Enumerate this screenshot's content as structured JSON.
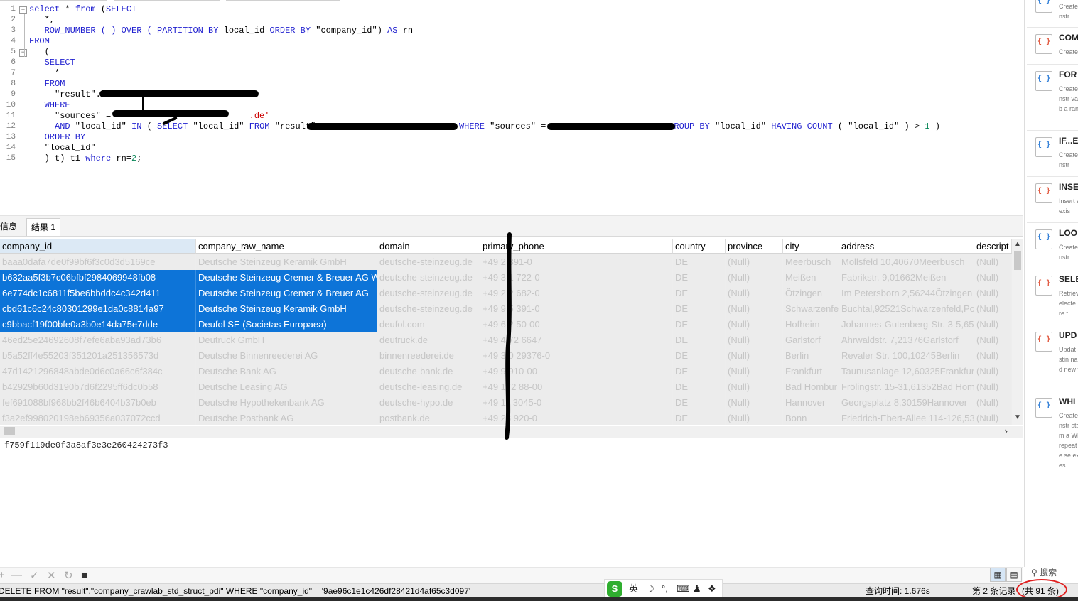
{
  "editor": {
    "line_numbers": [
      "1",
      "2",
      "3",
      "4",
      "5",
      "6",
      "7",
      "8",
      "9",
      "10",
      "11",
      "12",
      "13",
      "14",
      "15"
    ],
    "code_lines": [
      [
        {
          "t": "select",
          "c": "kw"
        },
        {
          "t": " * "
        },
        {
          "t": "from",
          "c": "kw"
        },
        {
          "t": " ("
        },
        {
          "t": "SELECT",
          "c": "kw"
        }
      ],
      [
        {
          "t": "   *,"
        }
      ],
      [
        {
          "t": "   ROW_NUMBER ( ) OVER ( PARTITION BY",
          "c": "kw"
        },
        {
          "t": " local_id "
        },
        {
          "t": "ORDER BY",
          "c": "kw"
        },
        {
          "t": " \"company_id\") "
        },
        {
          "t": "AS",
          "c": "kw"
        },
        {
          "t": " rn"
        }
      ],
      [
        {
          "t": "FROM",
          "c": "kw"
        }
      ],
      [
        {
          "t": "   ("
        }
      ],
      [
        {
          "t": "   SELECT",
          "c": "kw"
        }
      ],
      [
        {
          "t": "     *"
        }
      ],
      [
        {
          "t": "   FROM",
          "c": "kw"
        }
      ],
      [
        {
          "t": "     \"result\".\""
        }
      ],
      [
        {
          "t": "   WHERE",
          "c": "kw"
        }
      ],
      [
        {
          "t": "     \"sources\" = '"
        },
        {
          "t": "                         .de'",
          "c": "str"
        }
      ],
      [
        {
          "t": "     AND",
          "c": "kw"
        },
        {
          "t": " \"local_id\" "
        },
        {
          "t": "IN",
          "c": "kw"
        },
        {
          "t": " ( "
        },
        {
          "t": "SELECT",
          "c": "kw"
        },
        {
          "t": " \"local_id\" "
        },
        {
          "t": "FROM",
          "c": "kw"
        },
        {
          "t": " \"result\".                           "
        },
        {
          "t": "WHERE",
          "c": "kw"
        },
        {
          "t": " \"sources\" =                        "
        },
        {
          "t": "GROUP BY",
          "c": "kw"
        },
        {
          "t": " \"local_id\" "
        },
        {
          "t": "HAVING",
          "c": "kw"
        },
        {
          "t": " "
        },
        {
          "t": "COUNT",
          "c": "kw"
        },
        {
          "t": " ( \"local_id\" ) > "
        },
        {
          "t": "1",
          "c": "num"
        },
        {
          "t": " )"
        }
      ],
      [
        {
          "t": "   ORDER BY",
          "c": "kw"
        }
      ],
      [
        {
          "t": "   \"local_id\""
        }
      ],
      [
        {
          "t": "   ) t) t1 "
        },
        {
          "t": "where",
          "c": "kw"
        },
        {
          "t": " rn="
        },
        {
          "t": "2",
          "c": "num"
        },
        {
          "t": ";"
        }
      ]
    ]
  },
  "result_tabs": {
    "info": "信息",
    "result1": "结果 1"
  },
  "grid": {
    "columns": [
      "company_id",
      "company_raw_name",
      "domain",
      "primary_phone",
      "country",
      "province",
      "city",
      "address",
      "descript"
    ],
    "rows": [
      {
        "selected": false,
        "cells": [
          "baaa0dafa7de0f99bf6f3c0d3d5169ce",
          "Deutsche Steinzeug Keramik GmbH",
          "deutsche-steinzeug.de",
          "+49 2  391-0",
          "DE",
          "(Null)",
          "Meerbusch",
          "Mollsfeld 10,40670Meerbusch",
          "(Null)"
        ]
      },
      {
        "selected": true,
        "cells": [
          "b632aa5f3b7c06bfbf2984069948fb08",
          "Deutsche Steinzeug Cremer & Breuer AG W",
          "deutsche-steinzeug.de",
          "+49 3  1 722-0",
          "DE",
          "(Null)",
          "Meißen",
          "Fabrikstr. 9,01662Meißen",
          "(Null)"
        ]
      },
      {
        "selected": true,
        "cells": [
          "6e774dc1c6811f5be6bbddc4c342d411",
          "Deutsche Steinzeug Cremer & Breuer AG",
          "deutsche-steinzeug.de",
          "+49 2  2 682-0",
          "DE",
          "(Null)",
          "Ötzingen",
          "Im Petersborn 2,56244Ötzingen",
          "(Null)"
        ]
      },
      {
        "selected": true,
        "cells": [
          "cbd61c6c24c80301299e1da0c8814a97",
          "Deutsche Steinzeug Keramik GmbH",
          "deutsche-steinzeug.de",
          "+49 9  5 391-0",
          "DE",
          "(Null)",
          "Schwarzenfel",
          "Buchtal,92521Schwarzenfeld,Pos",
          "(Null)"
        ]
      },
      {
        "selected": true,
        "cells": [
          "c9bbacf19f00bfe0a3b0e14da75e7dde",
          "Deufol SE (Societas Europaea)",
          "deufol.com",
          "+49 6  2 50-00",
          "DE",
          "(Null)",
          "Hofheim",
          "Johannes-Gutenberg-Str. 3-5,65",
          "(Null)"
        ]
      },
      {
        "selected": false,
        "cells": [
          "46ed25e24692608f7efe6aba93ad73b6",
          "Deutruck GmbH",
          "deutruck.de",
          "+49 4  72 6647",
          "DE",
          "(Null)",
          "Garlstorf",
          "Ahrwaldstr. 7,21376Garlstorf",
          "(Null)"
        ]
      },
      {
        "selected": false,
        "cells": [
          "b5a52ff4e55203f351201a251356573d",
          "Deutsche Binnenreederei AG",
          "binnenreederei.de",
          "+49 3  0 29376-0",
          "DE",
          "(Null)",
          "Berlin",
          "Revaler Str. 100,10245Berlin",
          "(Null)"
        ]
      },
      {
        "selected": false,
        "cells": [
          "47d1421296848abde0d6c0a66c6f384c",
          "Deutsche Bank AG",
          "deutsche-bank.de",
          "+49  9 910-00",
          "DE",
          "(Null)",
          "Frankfurt",
          "Taunusanlage 12,60325Frankfurt",
          "(Null)"
        ]
      },
      {
        "selected": false,
        "cells": [
          "b42929b60d3190b7d6f2295ff6dc0b58",
          "Deutsche Leasing AG",
          "deutsche-leasing.de",
          "+49  172 88-00",
          "DE",
          "(Null)",
          "Bad Hombur",
          "Frölingstr. 15-31,61352Bad Hom",
          "(Null)"
        ]
      },
      {
        "selected": false,
        "cells": [
          "fef691088bf968bb2f46b6404b37b0eb",
          "Deutsche Hypothekenbank AG",
          "deutsche-hypo.de",
          "+49  11 3045-0",
          "DE",
          "(Null)",
          "Hannover",
          "Georgsplatz 8,30159Hannover",
          "(Null)"
        ]
      },
      {
        "selected": false,
        "cells": [
          "f3a2ef998020198eb69356a037072ccd",
          "Deutsche Postbank AG",
          "postbank.de",
          "+49  28 920-0",
          "DE",
          "(Null)",
          "Bonn",
          "Friedrich-Ebert-Allee 114-126,53",
          "(Null)"
        ]
      }
    ]
  },
  "cell_preview": "f759f119de0f3a8af3e3e260424273f3",
  "status": {
    "sql": "DELETE FROM \"result\".\"company_crawlab_std_struct_pdi\" WHERE \"company_id\" = '9ae96c1e1c426df28421d4af65c3d097'",
    "query_time": "查询时间: 1.676s",
    "record": "第 2 条记录",
    "total": "(共 91 条)"
  },
  "ime": {
    "lang": "英",
    "icons": [
      "☽",
      "°,",
      "⌨",
      "♟",
      "❖"
    ]
  },
  "grid_tools": [
    "+",
    "—",
    "✓",
    "✕",
    "↻",
    "■"
  ],
  "snippets": [
    {
      "title": "",
      "desc": "Create constr",
      "color": "#2b7bd6"
    },
    {
      "title": "COM",
      "desc": "Create",
      "color": "multi"
    },
    {
      "title": "FOR",
      "desc": "Create constr variab a rang",
      "color": "#2b7bd6"
    },
    {
      "title": "IF...E",
      "desc": "Create constr",
      "color": "#2b7bd6"
    },
    {
      "title": "INSE",
      "desc": "Insert an exis",
      "color": "multi"
    },
    {
      "title": "LOO",
      "desc": "Create constr",
      "color": "#2b7bd6"
    },
    {
      "title": "SELE",
      "desc": "Retriev selecte more t",
      "color": "multi"
    },
    {
      "title": "UPD",
      "desc": "Updat existin named new va",
      "color": "multi"
    },
    {
      "title": "WHI",
      "desc": "Create constr statem a WHI repeat the se expres",
      "color": "#2b7bd6"
    }
  ],
  "search_label": "搜索"
}
